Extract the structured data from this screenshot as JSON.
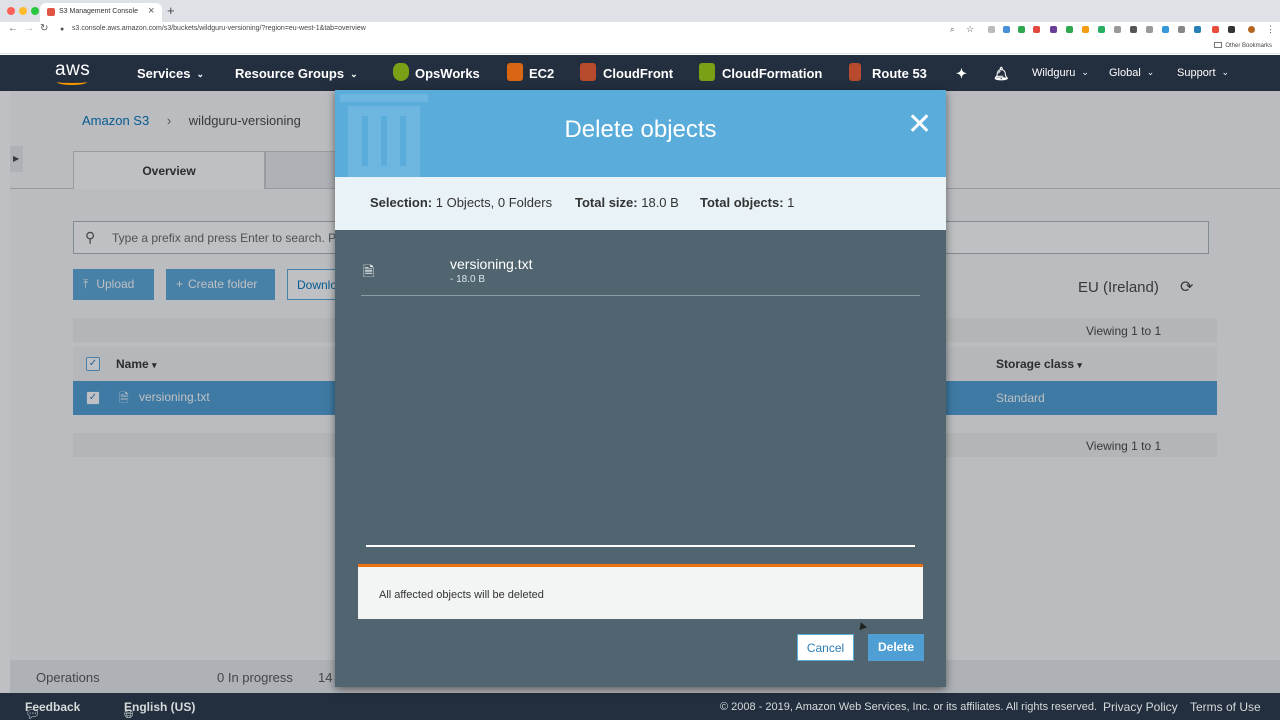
{
  "browser": {
    "tab_title": "S3 Management Console",
    "url": "s3.console.aws.amazon.com/s3/buckets/wildguru-versioning/?region=eu-west-1&tab=overview",
    "bookmarks_label": "Other Bookmarks"
  },
  "aws_nav": {
    "logo": "aws",
    "services": "Services",
    "resource_groups": "Resource Groups",
    "opsworks": "OpsWorks",
    "ec2": "EC2",
    "cloudfront": "CloudFront",
    "cloudformation": "CloudFormation",
    "route53": "Route 53",
    "account": "Wildguru",
    "region": "Global",
    "support": "Support"
  },
  "page": {
    "breadcrumb_root": "Amazon S3",
    "breadcrumb_bucket": "wildguru-versioning",
    "tab_overview": "Overview",
    "search_placeholder": "Type a prefix and press Enter to search. P",
    "upload": "Upload",
    "create_folder": "Create folder",
    "download": "Download",
    "region_name": "EU (Ireland)",
    "viewing": "Viewing 1 to 1",
    "col_name": "Name",
    "col_storage_class": "Storage class",
    "row_name": "versioning.txt",
    "row_storage_class": "Standard"
  },
  "operations": {
    "label": "Operations",
    "in_progress": "0 In progress",
    "count": "14"
  },
  "footer": {
    "feedback": "Feedback",
    "language": "English (US)",
    "copyright": "© 2008 - 2019, Amazon Web Services, Inc. or its affiliates. All rights reserved.",
    "privacy": "Privacy Policy",
    "terms": "Terms of Use"
  },
  "modal": {
    "title": "Delete objects",
    "selection_label": "Selection:",
    "selection_value": "1 Objects, 0 Folders",
    "total_size_label": "Total size:",
    "total_size_value": "18.0 B",
    "total_objects_label": "Total objects:",
    "total_objects_value": "1",
    "file_name": "versioning.txt",
    "file_size": "- 18.0 B",
    "warning": "All affected objects will be deleted",
    "cancel": "Cancel",
    "delete": "Delete"
  },
  "colors": {
    "aws_nav": "#232f3e",
    "modal_header": "#5aaddb",
    "modal_body": "#506570",
    "selected_row": "#4f9fd4",
    "warning_accent": "#ec7211"
  }
}
